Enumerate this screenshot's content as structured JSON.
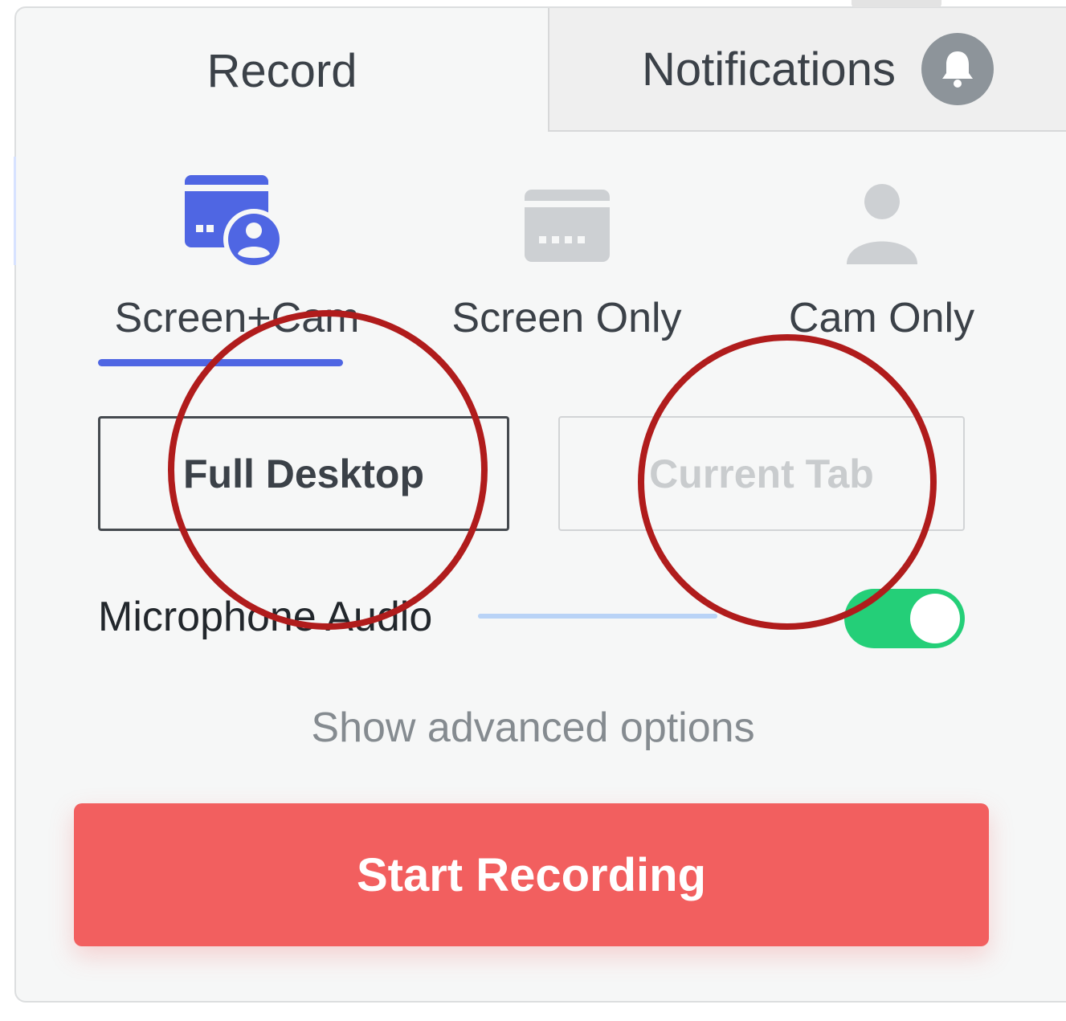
{
  "tabs": {
    "record_label": "Record",
    "notifications_label": "Notifications"
  },
  "modes": [
    {
      "label": "Screen+Cam",
      "icon": "screen-cam-icon",
      "selected": true
    },
    {
      "label": "Screen Only",
      "icon": "screen-icon",
      "selected": false
    },
    {
      "label": "Cam Only",
      "icon": "person-icon",
      "selected": false
    }
  ],
  "source": {
    "full_desktop_label": "Full Desktop",
    "current_tab_label": "Current Tab",
    "selected": "Full Desktop"
  },
  "microphone": {
    "label": "Microphone Audio",
    "enabled": true,
    "level_fraction": 1.0
  },
  "advanced_label": "Show advanced options",
  "start_label": "Start Recording",
  "colors": {
    "accent": "#4f66e3",
    "record": "#f25f5f",
    "toggle_on": "#24cf78",
    "annotation": "#b01c1c"
  }
}
